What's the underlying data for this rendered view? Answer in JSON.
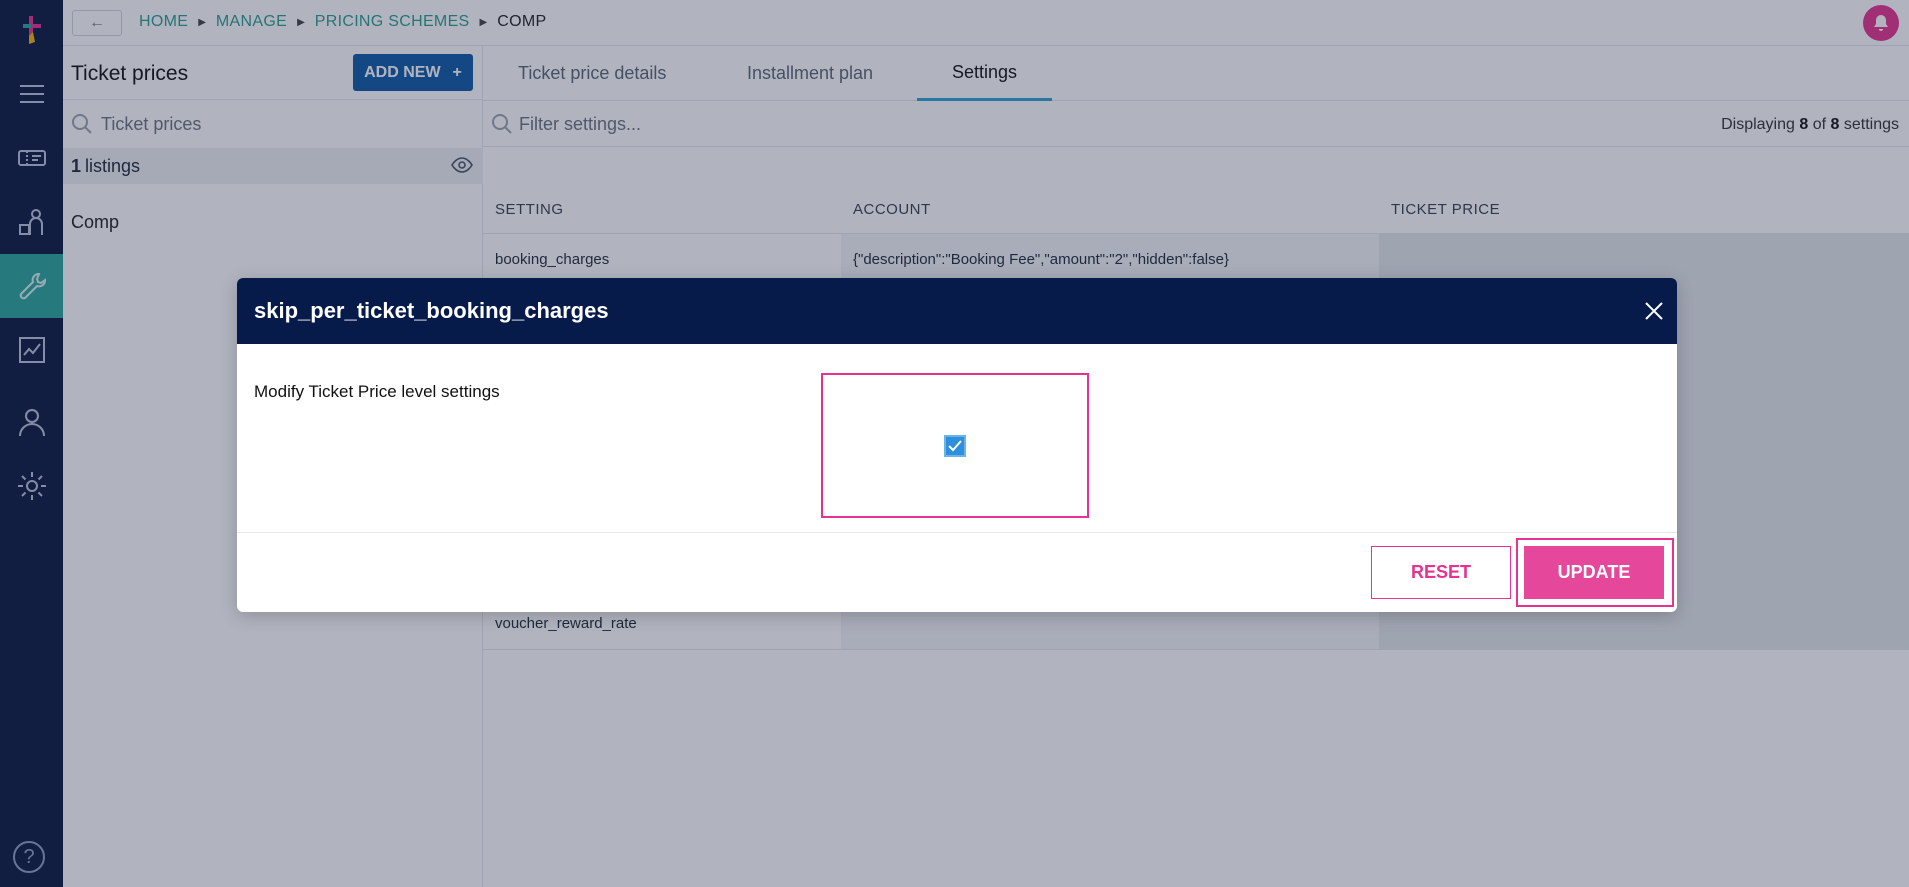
{
  "breadcrumb": [
    "HOME",
    "MANAGE",
    "PRICING SCHEMES",
    "COMP"
  ],
  "left_panel": {
    "title": "Ticket prices",
    "add_button": "ADD NEW",
    "add_icon": "+",
    "search_placeholder": "Ticket prices",
    "listings_count": "1",
    "listings_label": "listings",
    "items": [
      "Comp"
    ]
  },
  "tabs": [
    "Ticket price details",
    "Installment plan",
    "Settings"
  ],
  "active_tab": "Settings",
  "filter": {
    "placeholder": "Filter settings...",
    "displaying_prefix": "Displaying",
    "shown": "8",
    "of": "of",
    "total": "8",
    "suffix": "settings"
  },
  "table": {
    "headers": [
      "SETTING",
      "ACCOUNT",
      "TICKET PRICE"
    ],
    "rows": [
      {
        "setting": "booking_charges",
        "account": "{\"description\":\"Booking Fee\",\"amount\":\"2\",\"hidden\":false}",
        "ticket_price": ""
      },
      {
        "setting": "",
        "account": "",
        "ticket_price": ""
      },
      {
        "setting": "",
        "account": "",
        "ticket_price": ""
      },
      {
        "setting": "",
        "account": "",
        "ticket_price": ""
      },
      {
        "setting": "",
        "account": "",
        "ticket_price": ""
      },
      {
        "setting": "",
        "account": "",
        "ticket_price": ""
      },
      {
        "setting": "",
        "account": "",
        "ticket_price": ""
      },
      {
        "setting": "voucher_reward_rate",
        "account": "",
        "ticket_price": ""
      }
    ]
  },
  "modal": {
    "title": "skip_per_ticket_booking_charges",
    "label": "Modify Ticket Price level settings",
    "checkbox_checked": true,
    "reset": "RESET",
    "update": "UPDATE"
  },
  "help_glyph": "?",
  "colors": {
    "sidebar": "#0a1a3f",
    "accent_teal": "#2aa79a",
    "primary_blue": "#0e5aa7",
    "modal_header": "#061b4a",
    "highlight_pink": "#e5338f"
  }
}
